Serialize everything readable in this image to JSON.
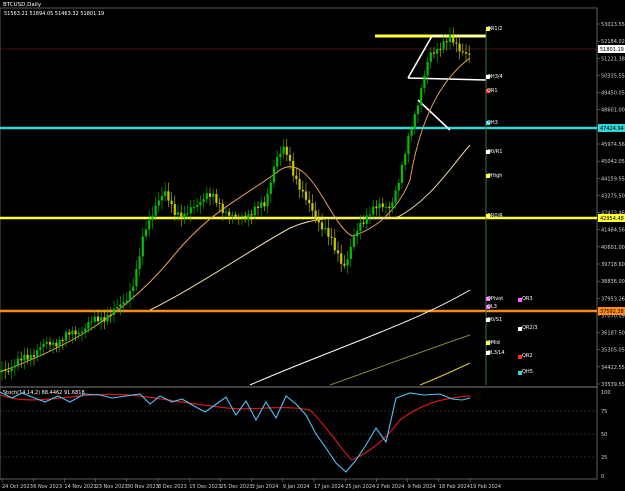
{
  "header": {
    "title": "BTCUSD,Daily",
    "ohlc": "51563.21 51894.05 51463.32 51801.19"
  },
  "oscillator": {
    "label": "Stoch(14,14,2) 88.4462 91.6818",
    "levels": [
      "100",
      "75",
      "50",
      "25",
      "0"
    ]
  },
  "price_axis": [
    "53013.55",
    "52184.02",
    "51221.38",
    "50335.55",
    "49450.05",
    "48601.00",
    "46887.55",
    "45974.56",
    "45042.05",
    "44159.55",
    "43275.50",
    "42413.46",
    "41484.56",
    "40601.00",
    "39718.60",
    "38836.00",
    "37953.26",
    "37070.09",
    "36187.50",
    "35305.05",
    "34422.55",
    "33539.55"
  ],
  "price_tags": {
    "current": "51801.19",
    "cyan_level": "47424.94",
    "yellow_level": "42954.48",
    "orange_level": "37592.38"
  },
  "date_axis": [
    "24 Oct 2023",
    "6 Nov 2023",
    "14 Nov 2023",
    "23 Nov 2023",
    "30 Nov 2023",
    "8 Dec 2023",
    "15 Dec 2023",
    "25 Dec 2023",
    "3 Jan 2024",
    "9 Jan 2024",
    "17 Jan 2024",
    "25 Jan 2024",
    "2 Feb 2024",
    "9 Feb 2024",
    "18 Feb 2024",
    "19 Feb 2024"
  ],
  "pivot_labels": [
    {
      "text": "QR1/2"
    },
    {
      "text": "QH3/4"
    },
    {
      "text": "QR1"
    },
    {
      "text": "QH3"
    },
    {
      "text": "Q0/R1"
    },
    {
      "text": "QHigh"
    },
    {
      "text": "QR0/R"
    },
    {
      "text": "QPivot"
    },
    {
      "text": "QL3"
    },
    {
      "text": "Q0/S1"
    },
    {
      "text": "QMid"
    },
    {
      "text": "QL3/L4"
    }
  ],
  "right_labels": [
    "QR3",
    "QR2/3",
    "QR2",
    "QH5"
  ],
  "colors": {
    "bull": "#00c000",
    "bear": "#c8c800",
    "cyan": "#33d6d6",
    "yellow": "#ffff33",
    "orange": "#ff8c1a",
    "stoch_main": "#4fc3f7",
    "stoch_signal": "#d01818"
  }
}
